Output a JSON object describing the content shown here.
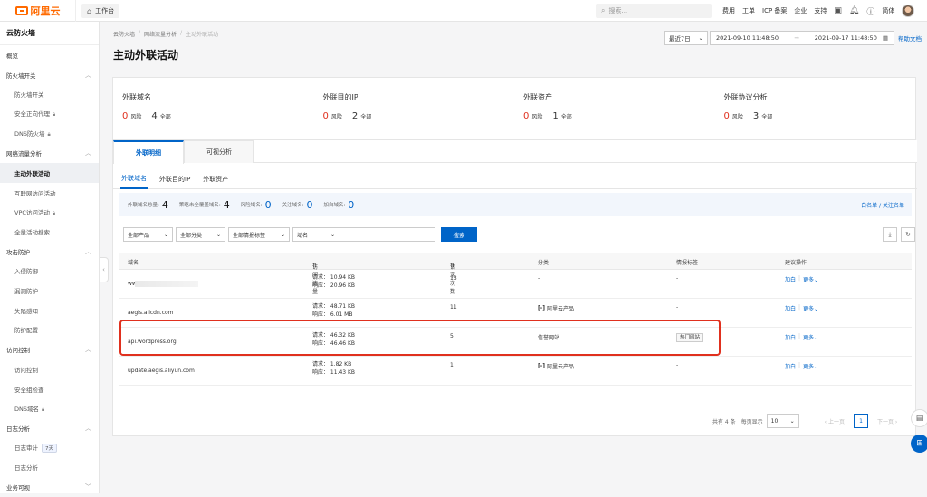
{
  "topbar": {
    "logo_text": "阿里云",
    "workbench": "工作台",
    "search_placeholder": "搜索...",
    "nav": [
      "费用",
      "工单",
      "ICP 备案",
      "企业",
      "支持"
    ],
    "lang": "简体"
  },
  "sidebar": {
    "title": "云防火墙",
    "overview": "概览",
    "g1": "防火墙开关",
    "g1_items": [
      "防火墙开关",
      "安全正向代理",
      "DNS防火墙"
    ],
    "g2": "网络流量分析",
    "g2_items": [
      "主动外联活动",
      "互联网访问活动",
      "VPC访问活动",
      "全量活动搜索"
    ],
    "g3": "攻击防护",
    "g3_items": [
      "入侵防御",
      "漏洞防护",
      "失陷感知",
      "防护配置"
    ],
    "g4": "访问控制",
    "g4_items": [
      "访问控制",
      "安全组检查",
      "DNS域名"
    ],
    "g5": "日志分析",
    "g5_items": [
      "日志审计",
      "日志分析"
    ],
    "audit_badge": "7天",
    "g6": "业务可视"
  },
  "breadcrumb": [
    "云防火墙",
    "网络流量分析",
    "主动外联活动"
  ],
  "page_title": "主动外联活动",
  "date": {
    "range_label": "最近7日",
    "start": "2021-09-10 11:48:50",
    "end": "2021-09-17 11:48:50",
    "help": "帮助文档"
  },
  "stats": [
    {
      "label": "外联域名",
      "risk": "0",
      "risk_label": "风险",
      "total": "4",
      "total_label": "全部"
    },
    {
      "label": "外联目的IP",
      "risk": "0",
      "risk_label": "风险",
      "total": "2",
      "total_label": "全部"
    },
    {
      "label": "外联资产",
      "risk": "0",
      "risk_label": "风险",
      "total": "1",
      "total_label": "全部"
    },
    {
      "label": "外联协议分析",
      "risk": "0",
      "risk_label": "风险",
      "total": "3",
      "total_label": "全部"
    }
  ],
  "main_tabs": [
    "外联明细",
    "可视分析"
  ],
  "sub_tabs": [
    "外联域名",
    "外联目的IP",
    "外联资产"
  ],
  "summary": {
    "total_label": "外联域名总量:",
    "total": "4",
    "uncovered_label": "策略未全覆盖域名:",
    "uncovered": "4",
    "risk_label": "风险域名:",
    "risk": "0",
    "watch_label": "关注域名:",
    "watch": "0",
    "white_label": "加白域名:",
    "white": "0",
    "whitelist_link": "白名单 / 关注名单"
  },
  "filters": {
    "product": "全部产品",
    "category": "全部分类",
    "intel": "全部情报标签",
    "field": "域名",
    "search_btn": "搜索"
  },
  "table": {
    "headers": [
      "域名",
      "访问流量",
      "请求次数",
      "分类",
      "情报标签",
      "建议操作"
    ],
    "rows": [
      {
        "domain": "ww",
        "req": "请求： 10.94 KB",
        "resp": "响应： 20.96 KB",
        "count": "13",
        "category": "-",
        "tag": "-",
        "op1": "加白",
        "op2": "更多"
      },
      {
        "domain": "aegis.alicdn.com",
        "req": "请求： 48.71 KB",
        "resp": "响应： 6.01 MB",
        "count": "11",
        "category": "阿里云产品",
        "tag": "-",
        "op1": "加白",
        "op2": "更多"
      },
      {
        "domain": "api.wordpress.org",
        "req": "请求： 46.32 KB",
        "resp": "响应： 46.46 KB",
        "count": "5",
        "category": "信誉网站",
        "tag": "热门网站",
        "op1": "加白",
        "op2": "更多"
      },
      {
        "domain": "update.aegis.aliyun.com",
        "req": "请求： 1.82 KB",
        "resp": "响应： 11.43 KB",
        "count": "1",
        "category": "阿里云产品",
        "tag": "-",
        "op1": "加白",
        "op2": "更多"
      }
    ]
  },
  "pager": {
    "total": "共有 4 条",
    "per_page_label": "每页显示",
    "page_size": "10",
    "prev": "上一页",
    "current": "1",
    "next": "下一页"
  },
  "colors": {
    "brand": "#ff6a00",
    "primary": "#0064c8",
    "risk": "#e0301e"
  }
}
